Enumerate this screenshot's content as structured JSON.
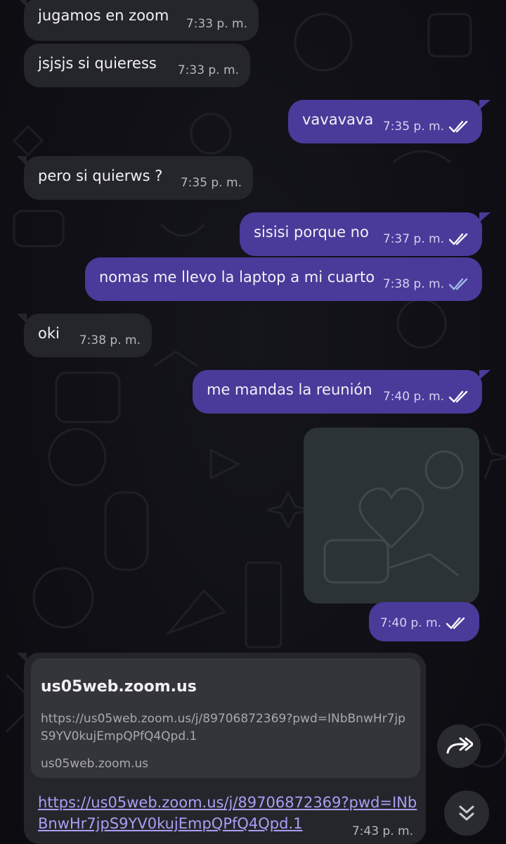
{
  "messages": [
    {
      "dir": "in",
      "text": "jugamos en zoom",
      "time": "7:33 p. m."
    },
    {
      "dir": "in",
      "text": "jsjsjs si quieress",
      "time": "7:33 p. m."
    },
    {
      "dir": "out",
      "text": "vavavava",
      "time": "7:35 p. m."
    },
    {
      "dir": "in",
      "text": "pero si quierws ?",
      "time": "7:35 p. m."
    },
    {
      "dir": "out",
      "text": "sisisi porque no",
      "time": "7:37 p. m."
    },
    {
      "dir": "out",
      "text": "nomas me llevo la laptop a mi cuarto",
      "time": "7:38 p. m."
    },
    {
      "dir": "in",
      "text": "oki",
      "time": "7:38 p. m."
    },
    {
      "dir": "out",
      "text": "me mandas la reunión",
      "time": "7:40 p. m."
    }
  ],
  "media_message": {
    "time": "7:40 p. m."
  },
  "link_message": {
    "preview_title": "us05web.zoom.us",
    "preview_url": "https://us05web.zoom.us/j/89706872369?pwd=INbBnwHr7jpS9YV0kujEmpQPfQ4Qpd.1",
    "preview_domain": "us05web.zoom.us",
    "link": "https://us05web.zoom.us/j/89706872369?pwd=INbBnwHr7jpS9YV0kujEmpQPfQ4Qpd.1",
    "time": "7:43 p. m."
  },
  "icons": {
    "ticks": "double-check-icon",
    "forward": "forward-icon",
    "scroll_down": "chevrons-down-icon"
  },
  "colors": {
    "incoming_bubble": "#25262b",
    "outgoing_bubble": "#4a3a9a",
    "link": "#a89ff5"
  }
}
